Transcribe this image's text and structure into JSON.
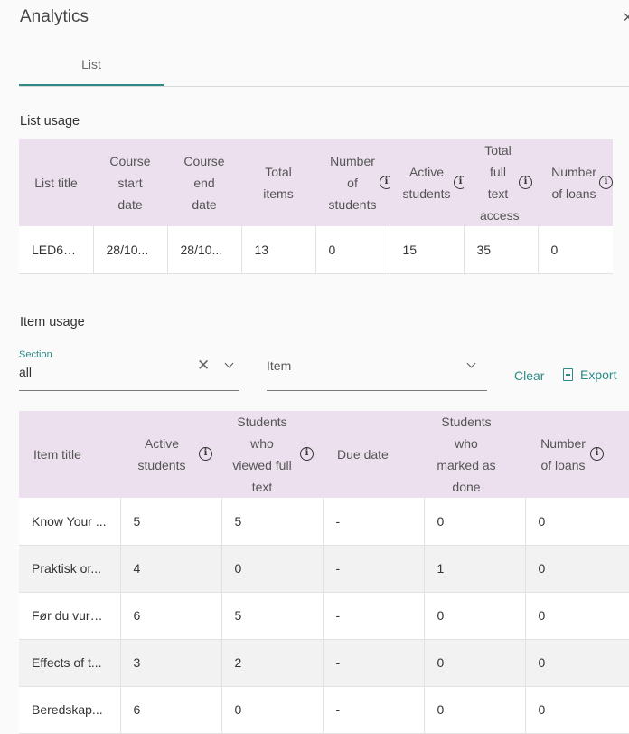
{
  "header": {
    "title": "Analytics",
    "close_label": "×"
  },
  "tabs": [
    {
      "label": "List"
    }
  ],
  "list_usage": {
    "title": "List usage",
    "columns": [
      "List title",
      "Course start date",
      "Course end date",
      "Total items",
      "Number of students",
      "Active students",
      "Total full text access",
      "Number of loans"
    ],
    "rows": [
      [
        "LED60...",
        "28/10...",
        "28/10...",
        "13",
        "0",
        "15",
        "35",
        "0"
      ]
    ]
  },
  "item_usage": {
    "title": "Item usage",
    "section_filter": {
      "label": "Section",
      "value": "all"
    },
    "item_filter": {
      "placeholder": "Item"
    },
    "clear_label": "Clear",
    "export_label": "Export",
    "columns": [
      "Item title",
      "Active students",
      "Students who viewed full text",
      "Due date",
      "Students who marked as done",
      "Number of loans"
    ],
    "rows": [
      [
        "Know Your ...",
        "5",
        "5",
        "-",
        "0",
        "0"
      ],
      [
        "Praktisk or...",
        "4",
        "0",
        "-",
        "1",
        "0"
      ],
      [
        "Før du vurd...",
        "6",
        "5",
        "-",
        "0",
        "0"
      ],
      [
        "Effects of t...",
        "3",
        "2",
        "-",
        "0",
        "0"
      ],
      [
        "Beredskap...",
        "6",
        "0",
        "-",
        "0",
        "0"
      ]
    ]
  },
  "colors": {
    "accent": "#2e8a86",
    "header_bg": "#ece0ee"
  },
  "icons": {
    "info": "info-icon",
    "close": "close-icon",
    "clear": "clear-icon",
    "dropdown": "chevron-down-icon",
    "export": "export-icon"
  }
}
